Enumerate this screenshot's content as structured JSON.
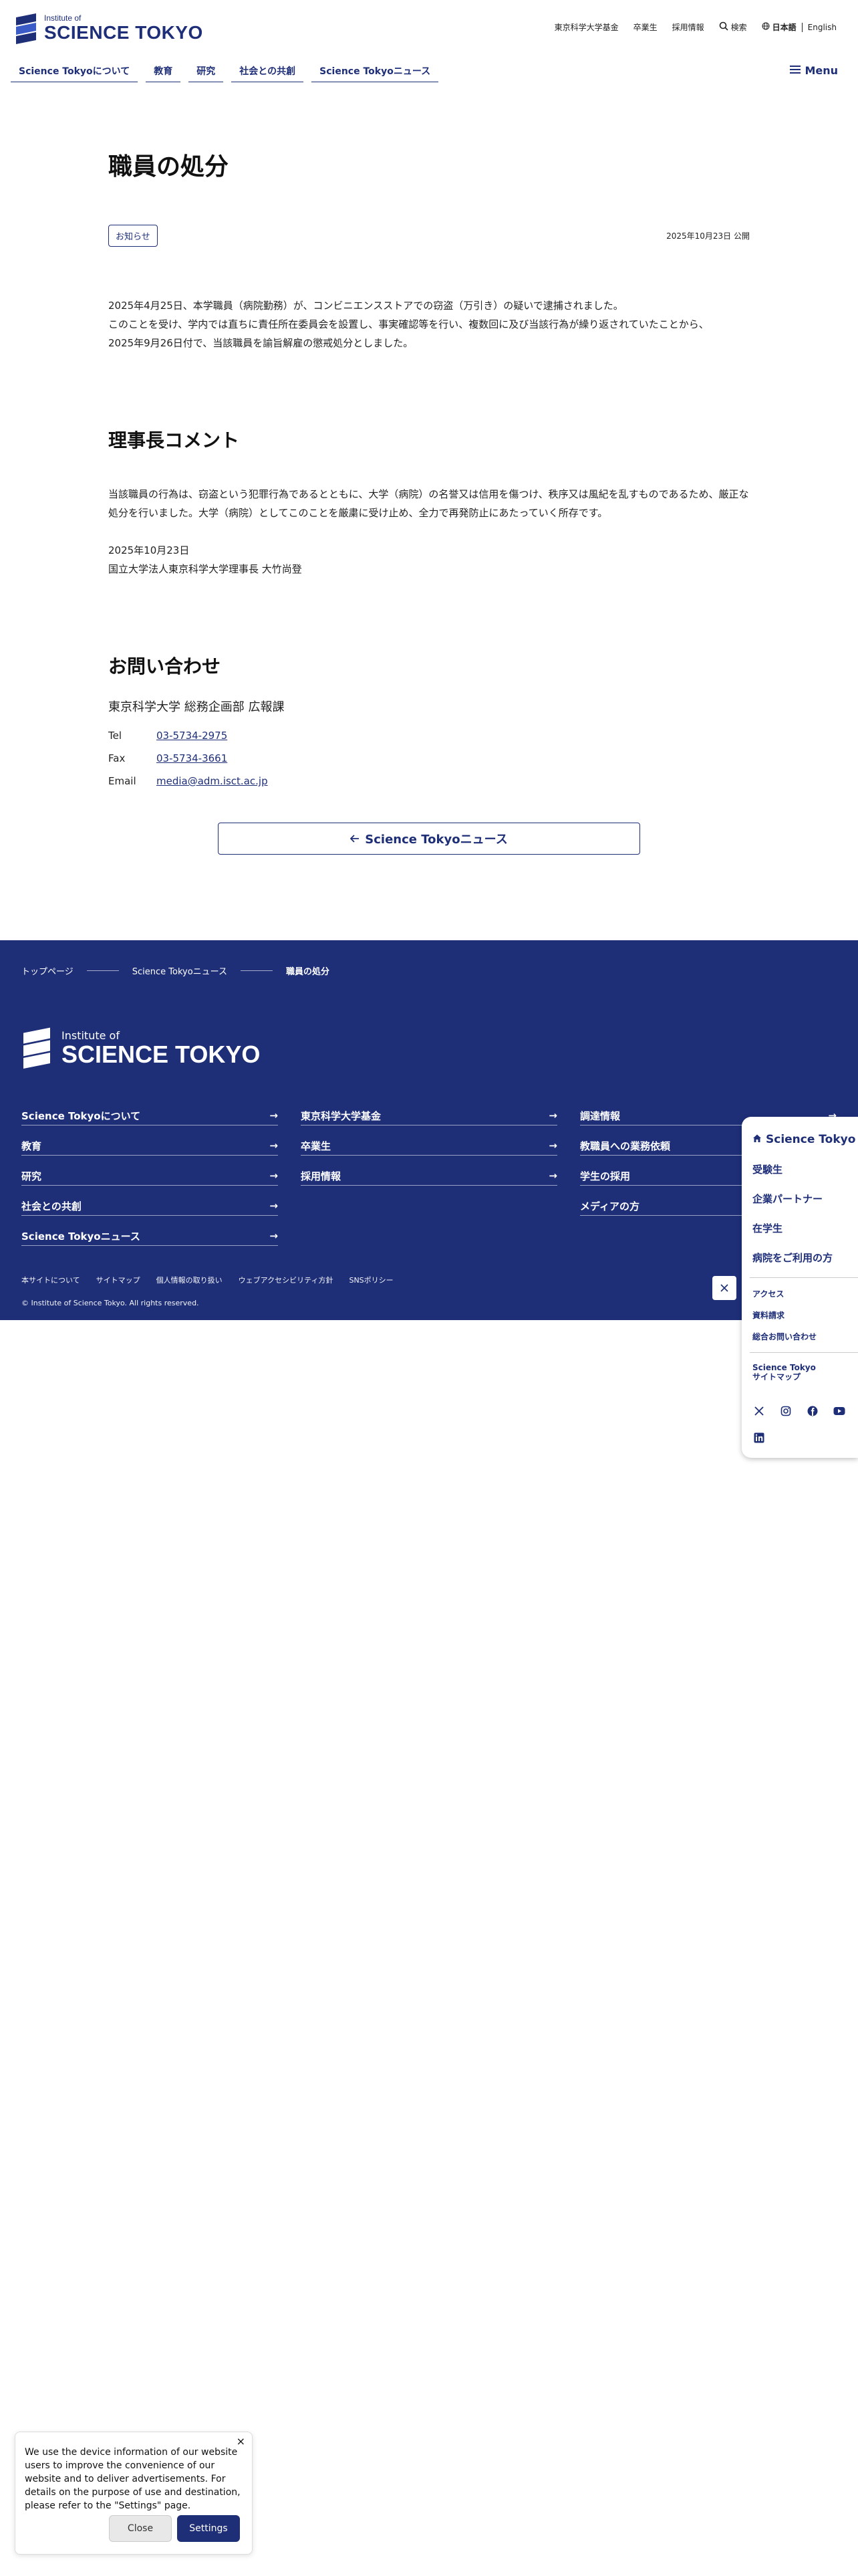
{
  "header": {
    "logo_small": "Institute of",
    "logo_big": "SCIENCE TOKYO",
    "util_links": [
      "東京科学大学基金",
      "卒業生",
      "採用情報"
    ],
    "search_label": "検索",
    "lang_current": "日本語",
    "lang_other": "English",
    "gnav": [
      "Science Tokyoについて",
      "教育",
      "研究",
      "社会との共創",
      "Science Tokyoニュース"
    ],
    "menu_label": "Menu"
  },
  "article": {
    "title": "職員の処分",
    "tag": "お知らせ",
    "date": "2025年10月23日 公開",
    "paragraphs": [
      "2025年4月25日、本学職員（病院勤務）が、コンビニエンスストアでの窃盗（万引き）の疑いで逮捕されました。",
      "このことを受け、学内では直ちに責任所在委員会を設置し、事実確認等を行い、複数回に及び当該行為が繰り返されていたことから、",
      "2025年9月26日付で、当該職員を諭旨解雇の懲戒処分としました。"
    ],
    "comment_heading": "理事長コメント",
    "comment_text": "当該職員の行為は、窃盗という犯罪行為であるとともに、大学（病院）の名誉又は信用を傷つけ、秩序又は風紀を乱すものであるため、厳正な処分を行いました。大学（病院）としてこのことを厳粛に受け止め、全力で再発防止にあたっていく所存です。",
    "comment_date": "2025年10月23日",
    "comment_signer": "国立大学法人東京科学大学理事長 大竹尚登"
  },
  "contact": {
    "heading": "お問い合わせ",
    "dept": "東京科学大学 総務企画部 広報課",
    "tel_label": "Tel",
    "tel": "03-5734-2975",
    "fax_label": "Fax",
    "fax": "03-5734-3661",
    "email_label": "Email",
    "email": "media@adm.isct.ac.jp"
  },
  "back_button": "Science Tokyoニュース",
  "footer": {
    "breadcrumb": [
      "トップページ",
      "Science Tokyoニュース",
      "職員の処分"
    ],
    "logo_small": "Institute of",
    "logo_big": "SCIENCE TOKYO",
    "col1": [
      "Science Tokyoについて",
      "教育",
      "研究",
      "社会との共創",
      "Science Tokyoニュース"
    ],
    "col2": [
      "東京科学大学基金",
      "卒業生",
      "採用情報"
    ],
    "col3": [
      "調達情報",
      "教職員への業務依頼",
      "学生の採用",
      "メディアの方"
    ],
    "bottom_links": [
      "本サイトについて",
      "サイトマップ",
      "個人情報の取り扱い",
      "ウェブアクセシビリティ方針",
      "SNSポリシー"
    ],
    "copyright": "© Institute of Science Tokyo. All rights reserved."
  },
  "side_panel": {
    "title": "Science Tokyo",
    "main_links": [
      "受験生",
      "企業パートナー",
      "在学生",
      "病院をご利用の方"
    ],
    "sub_links": [
      "アクセス",
      "資料請求",
      "総合お問い合わせ"
    ],
    "sitemap_line1": "Science Tokyo",
    "sitemap_line2": "サイトマップ",
    "social": [
      "x-icon",
      "instagram-icon",
      "facebook-icon",
      "youtube-icon",
      "linkedin-icon"
    ]
  },
  "cookie": {
    "text": "We use the device information of our website users to improve the convenience of our website and to deliver advertisements. For details on the purpose of use and destination, please refer to the \"Settings\" page.",
    "close_label": "Close",
    "settings_label": "Settings"
  },
  "colors": {
    "brand": "#1e2f78"
  }
}
